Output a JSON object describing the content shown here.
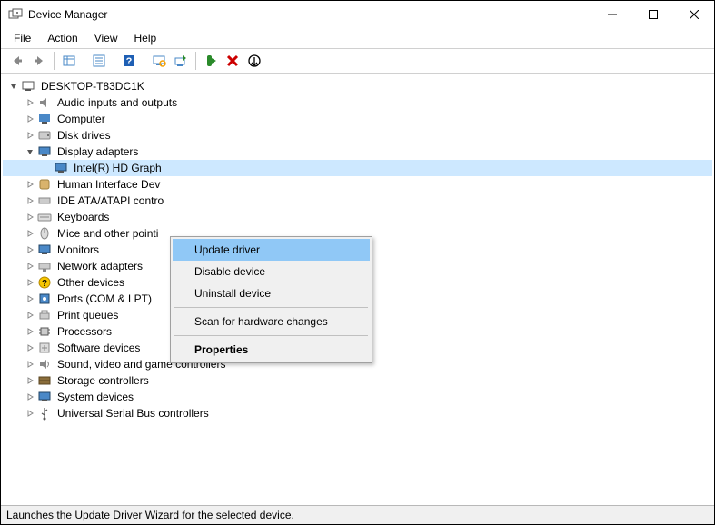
{
  "title": "Device Manager",
  "menu": {
    "file": "File",
    "action": "Action",
    "view": "View",
    "help": "Help"
  },
  "status": "Launches the Update Driver Wizard for the selected device.",
  "root": "DESKTOP-T83DC1K",
  "nodes": {
    "audio": "Audio inputs and outputs",
    "computer": "Computer",
    "disks": "Disk drives",
    "display": "Display adapters",
    "display_child": "Intel(R) HD Graph",
    "hid": "Human Interface Dev",
    "ide": "IDE ATA/ATAPI contro",
    "keyboards": "Keyboards",
    "mice": "Mice and other pointi",
    "monitors": "Monitors",
    "network": "Network adapters",
    "other": "Other devices",
    "ports": "Ports (COM & LPT)",
    "printq": "Print queues",
    "processors": "Processors",
    "software": "Software devices",
    "sound": "Sound, video and game controllers",
    "storage": "Storage controllers",
    "system": "System devices",
    "usb": "Universal Serial Bus controllers"
  },
  "ctx": {
    "update": "Update driver",
    "disable": "Disable device",
    "uninstall": "Uninstall device",
    "scan": "Scan for hardware changes",
    "props": "Properties"
  }
}
